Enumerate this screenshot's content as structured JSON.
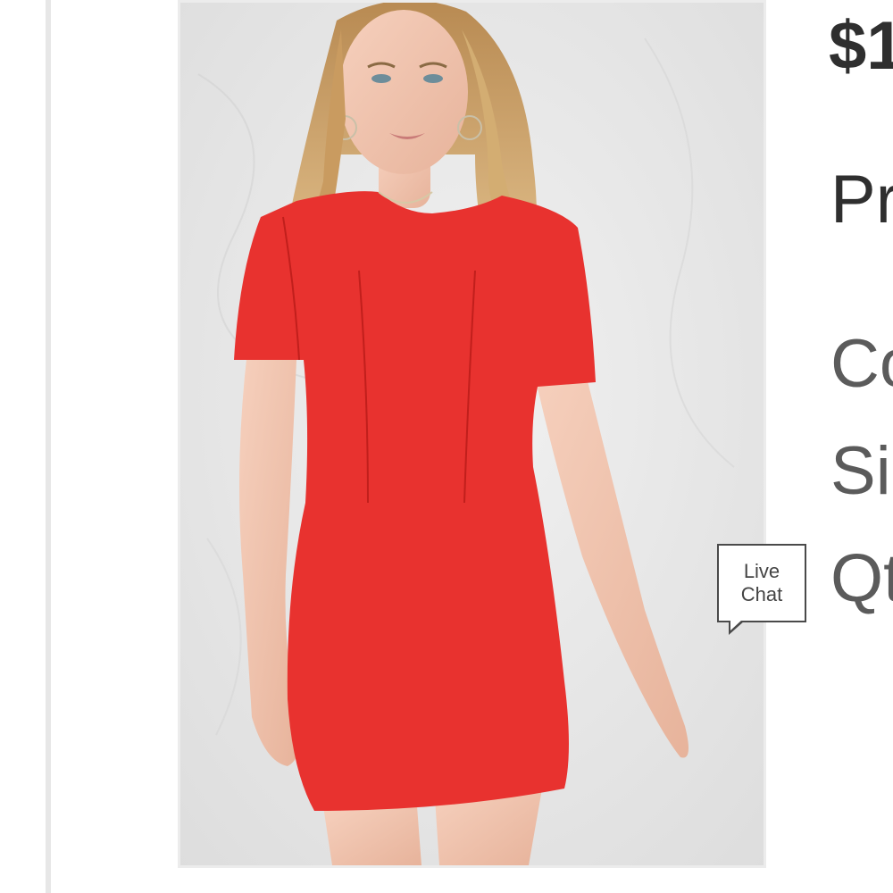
{
  "product": {
    "image_alt": "Model wearing a red short-sleeve bodycon mini dress",
    "dress_color": "#e8322f",
    "price_text": "$1",
    "labels": {
      "price_label": "Pr",
      "color_label": "Co",
      "size_label": "Si",
      "qty_label": "Qt"
    }
  },
  "live_chat": {
    "line1": "Live",
    "line2": "Chat"
  }
}
